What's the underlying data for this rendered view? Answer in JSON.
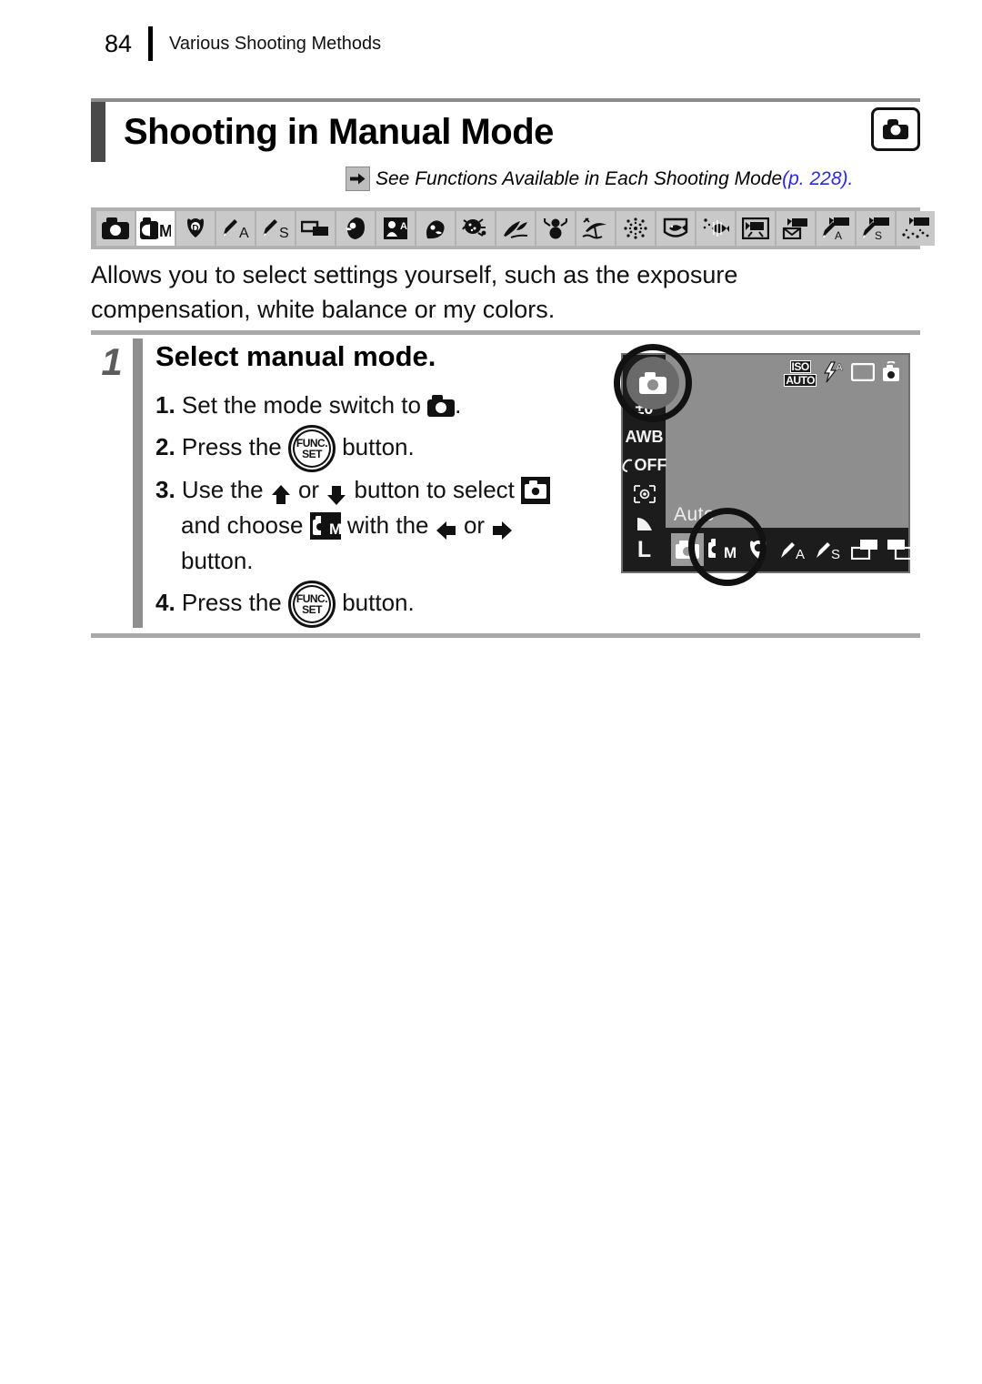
{
  "header": {
    "page_number": "84",
    "section_title": "Various Shooting Methods"
  },
  "title": {
    "text": "Shooting in Manual Mode",
    "mode_icon": "camera-icon"
  },
  "cross_reference": {
    "arrow_icon": "arrow-right-icon",
    "text": "See Functions Available in Each Shooting Mode ",
    "page_ref": "(p. 228).",
    "link_color": "#2a2ae0"
  },
  "mode_strip": {
    "background": "#b2b2b2",
    "active_background": "#ffffff",
    "tile_background": "#c9c9c9",
    "icons": [
      {
        "name": "auto-camera-icon",
        "label": "Auto",
        "active": false
      },
      {
        "name": "manual-cm-icon",
        "label": "M",
        "active": true
      },
      {
        "name": "digital-macro-icon",
        "label": "Digital Macro",
        "active": false
      },
      {
        "name": "shutter-priority-a-icon",
        "label": "A",
        "active": false
      },
      {
        "name": "shutter-priority-s-icon",
        "label": "S",
        "active": false
      },
      {
        "name": "stitch-assist-icon",
        "label": "Stitch Assist",
        "active": false
      },
      {
        "name": "portrait-icon",
        "label": "Portrait",
        "active": false
      },
      {
        "name": "night-snapshot-icon",
        "label": "Night Snapshot",
        "active": false
      },
      {
        "name": "kids-and-pets-icon",
        "label": "Kids&Pets",
        "active": false
      },
      {
        "name": "indoor-icon",
        "label": "Indoor",
        "active": false
      },
      {
        "name": "foliage-icon",
        "label": "Foliage",
        "active": false
      },
      {
        "name": "snow-icon",
        "label": "Snow",
        "active": false
      },
      {
        "name": "beach-icon",
        "label": "Beach",
        "active": false
      },
      {
        "name": "fireworks-icon",
        "label": "Fireworks",
        "active": false
      },
      {
        "name": "aquarium-icon",
        "label": "Aquarium",
        "active": false
      },
      {
        "name": "underwater-icon",
        "label": "Underwater",
        "active": false
      },
      {
        "name": "movie-standard-icon",
        "label": "Movie Standard",
        "active": false
      },
      {
        "name": "movie-compact-icon",
        "label": "Compact",
        "active": false
      },
      {
        "name": "movie-color-accent-icon",
        "label": "Color Accent",
        "active": false
      },
      {
        "name": "movie-color-swap-icon",
        "label": "Color Swap",
        "active": false
      },
      {
        "name": "movie-time-lapse-icon",
        "label": "Time Lapse",
        "active": false
      }
    ]
  },
  "intro": {
    "text": "Allows you to select settings yourself, such as the exposure compensation, white balance or my colors."
  },
  "step": {
    "number": "1",
    "heading": "Select manual mode.",
    "substeps": [
      {
        "num": "1.",
        "before": "Set the mode switch to ",
        "icon": "camera-icon",
        "after": "."
      },
      {
        "num": "2.",
        "before": "Press the ",
        "icon": "func-set-button",
        "after": " button."
      },
      {
        "num": "3.",
        "before": "Use the ",
        "icon": "arrow-up-icon",
        "middle1": " or ",
        "icon2": "arrow-down-icon",
        "middle2": " button to select ",
        "icon3": "select-camera-icon",
        "after": ""
      },
      {
        "num": "",
        "before": "and choose ",
        "icon": "manual-cm-icon",
        "middle1": " with the ",
        "icon2": "arrow-left-icon",
        "middle2": " or ",
        "icon3": "arrow-right-icon",
        "after": ""
      },
      {
        "num": "",
        "before": "button.",
        "icon": "",
        "after": ""
      },
      {
        "num": "4.",
        "before": "Press the ",
        "icon": "func-set-button",
        "after": " button."
      }
    ],
    "func_button": {
      "line1": "FUNC.",
      "line2": "SET"
    }
  },
  "lcd": {
    "background": "#8e8e8e",
    "sidebar_background": "#1c1c1c",
    "sidebar_items": [
      {
        "name": "exposure-compensation-icon",
        "label": "±0"
      },
      {
        "name": "white-balance-icon",
        "label": "AWB"
      },
      {
        "name": "my-colors-off-icon",
        "label": "OFF"
      },
      {
        "name": "metering-mode-icon",
        "label": ""
      },
      {
        "name": "compression-quality-icon",
        "label": ""
      },
      {
        "name": "image-size-icon",
        "label": "L"
      }
    ],
    "top_icons": [
      {
        "name": "iso-auto-icon",
        "line1": "ISO",
        "line2": "AUTO"
      },
      {
        "name": "flash-auto-icon",
        "label": "A"
      },
      {
        "name": "drive-single-icon",
        "label": ""
      },
      {
        "name": "camera-shake-warning-icon",
        "label": ""
      }
    ],
    "mode_label": "Auto",
    "bottom_modes": [
      {
        "name": "lcd-mode-auto-icon",
        "label": "",
        "selected": false
      },
      {
        "name": "lcd-mode-manual-cm-icon",
        "label": "M",
        "selected": true
      },
      {
        "name": "lcd-mode-digital-macro-icon",
        "label": "",
        "selected": false
      },
      {
        "name": "lcd-mode-a-icon",
        "label": "A",
        "selected": false
      },
      {
        "name": "lcd-mode-s-icon",
        "label": "S",
        "selected": false
      },
      {
        "name": "lcd-mode-stitch-left-icon",
        "label": "",
        "selected": false
      },
      {
        "name": "lcd-mode-stitch-right-icon",
        "label": "",
        "selected": false
      }
    ],
    "callout_top": "mode-switch-callout-circle",
    "callout_bottom": "manual-mode-callout-circle"
  }
}
